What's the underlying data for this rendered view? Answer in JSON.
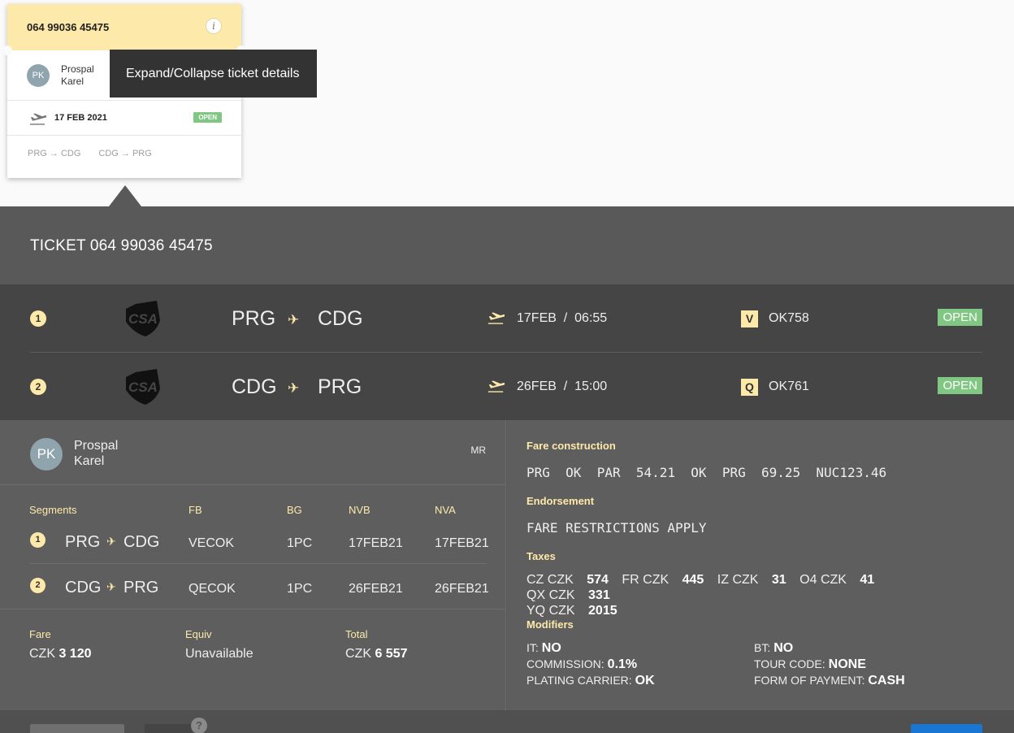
{
  "card": {
    "ticket_number": "064 99036 45475",
    "info_glyph": "i",
    "avatar_initials": "PK",
    "pax_first": "Prospal",
    "pax_last": "Karel",
    "date": "17 FEB 2021",
    "status": "OPEN",
    "route1": "PRG → CDG",
    "route2": "CDG → PRG"
  },
  "tooltip": "Expand/Collapse ticket details",
  "panel": {
    "title": "TICKET 064 99036 45475",
    "segments": [
      {
        "index": "1",
        "from": "PRG",
        "to": "CDG",
        "departure": "17FEB  /  06:55",
        "class": "V",
        "flight": "OK758",
        "status": "OPEN"
      },
      {
        "index": "2",
        "from": "CDG",
        "to": "PRG",
        "departure": "26FEB  /  15:00",
        "class": "Q",
        "flight": "OK761",
        "status": "OPEN"
      }
    ],
    "passenger": {
      "initials": "PK",
      "first": "Prospal",
      "last": "Karel",
      "title": "MR"
    },
    "table_headers": {
      "segments": "Segments",
      "fb": "FB",
      "bg": "BG",
      "nvb": "NVB",
      "nva": "NVA"
    },
    "table_rows": [
      {
        "index": "1",
        "from": "PRG",
        "to": "CDG",
        "fb": "VECOK",
        "bg": "1PC",
        "nvb": "17FEB21",
        "nva": "17FEB21"
      },
      {
        "index": "2",
        "from": "CDG",
        "to": "PRG",
        "fb": "QECOK",
        "bg": "1PC",
        "nvb": "26FEB21",
        "nva": "26FEB21"
      }
    ],
    "fare": {
      "fare_label": "Fare",
      "fare_cur": "CZK",
      "fare_amt": "3 120",
      "equiv_label": "Equiv",
      "equiv_val": "Unavailable",
      "total_label": "Total",
      "total_cur": "CZK",
      "total_amt": "6 557"
    },
    "fare_construction": {
      "label": "Fare construction",
      "value": "PRG  OK  PAR  54.21  OK  PRG  69.25  NUC123.46",
      "endorsement_label": "Endorsement",
      "endorsement": "FARE RESTRICTIONS APPLY",
      "taxes_label": "Taxes",
      "taxes": [
        {
          "code": "CZ CZK",
          "amount": "574"
        },
        {
          "code": "FR CZK",
          "amount": "445"
        },
        {
          "code": "IZ CZK",
          "amount": "31"
        },
        {
          "code": "O4 CZK",
          "amount": "41"
        },
        {
          "code": "QX CZK",
          "amount": "331"
        },
        {
          "code": "YQ CZK",
          "amount": "2015"
        }
      ],
      "modifiers_label": "Modifiers",
      "modifiers": {
        "it_label": "IT:",
        "it": "NO",
        "bt_label": "BT:",
        "bt": "NO",
        "commission_label": "COMMISSION:",
        "commission": "0.1%",
        "tour_label": "TOUR CODE:",
        "tour": "NONE",
        "plating_label": "PLATING CARRIER:",
        "plating": "OK",
        "fop_label": "FORM OF PAYMENT:",
        "fop": "CASH"
      }
    },
    "help_glyph": "?"
  },
  "colors": {
    "accent": "#fde9a9",
    "open_badge": "#81c784",
    "panel": "#595959",
    "primary_button": "#1976d2"
  },
  "icons": {
    "info": "info-icon",
    "departure": "takeoff-icon",
    "plane": "plane-icon",
    "airline": "csa-logo",
    "help": "help-icon"
  }
}
